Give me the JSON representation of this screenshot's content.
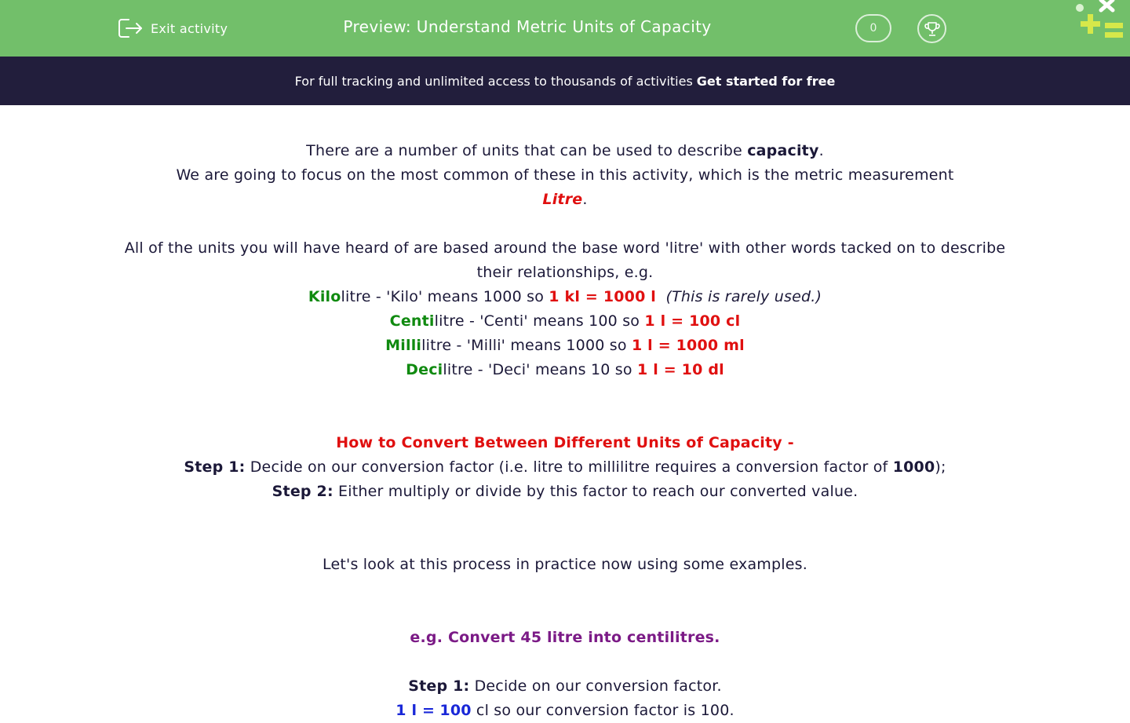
{
  "header": {
    "exit_label": "Exit activity",
    "title": "Preview: Understand Metric Units of Capacity",
    "score": "0",
    "accent_color": "#72bf6a"
  },
  "banner": {
    "text": "For full tracking and unlimited access to thousands of activities",
    "cta": "Get started for free",
    "background_color": "#221e3c"
  },
  "content": {
    "intro": {
      "l1_a": "There are a number of units that can be used to describe",
      "l1_bold": "capacity",
      "l1_end": ".",
      "l2": "We are going to focus on the most common of these in this activity, which is the metric measurement",
      "l3_red": "Litre",
      "l3_end": "."
    },
    "units_intro": "All of the units you will have heard of are based around the base word 'litre' with other words tacked on to describe their relationships, e.g.",
    "units": [
      {
        "prefix": "Kilo",
        "text": "litre - 'Kilo' means 1000 so",
        "conversion": "1 kl = 1000 l",
        "note": "(This is rarely used.)"
      },
      {
        "prefix": "Centi",
        "text": "litre - 'Centi' means 100 so",
        "conversion": "1 l = 100 cl",
        "note": ""
      },
      {
        "prefix": "Milli",
        "text": "litre - 'Milli' means 1000 so",
        "conversion": "1 l = 1000 ml",
        "note": ""
      },
      {
        "prefix": "Deci",
        "text": "litre - 'Deci' means 10 so",
        "conversion": "1 l = 10 dl",
        "note": ""
      }
    ],
    "howto": {
      "heading": "How to Convert Between Different Units of Capacity -",
      "step1_label": "Step 1:",
      "step1_text": "Decide on our conversion factor (i.e. litre to millilitre requires a conversion factor of",
      "step1_bold": "1000",
      "step1_end": ");",
      "step2_label": "Step 2:",
      "step2_text": "Either multiply or divide by this factor to reach our converted value."
    },
    "examples_intro": "Let's look at this process in practice now using some examples.",
    "example": {
      "heading": "e.g. Convert 45 litre into centilitres.",
      "step1_label": "Step 1:",
      "step1_text": "Decide on our conversion factor.",
      "partial_a": "1 l =",
      "partial_bold": "100",
      "partial_b": "cl so our conversion factor is 100."
    }
  }
}
